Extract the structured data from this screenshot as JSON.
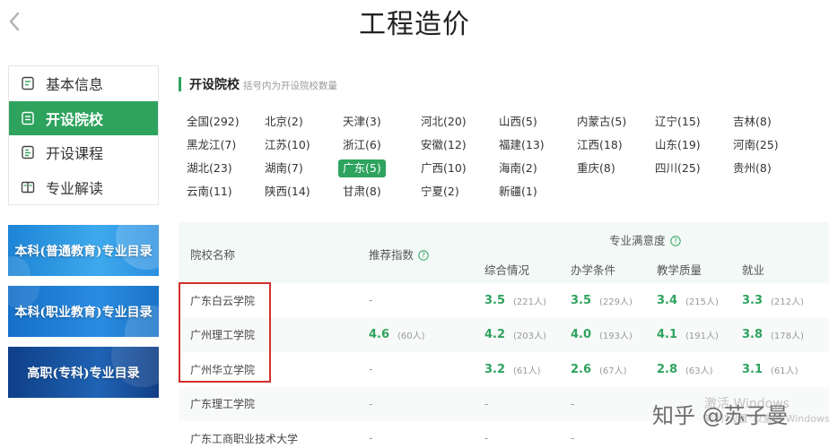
{
  "page": {
    "title": "工程造价"
  },
  "sidebar": {
    "items": [
      {
        "label": "基本信息",
        "icon": "document-icon"
      },
      {
        "label": "开设院校",
        "icon": "school-list-icon"
      },
      {
        "label": "开设课程",
        "icon": "course-icon"
      },
      {
        "label": "专业解读",
        "icon": "book-icon"
      }
    ],
    "active_index": 1,
    "banners": [
      "本科(普通教育)专业目录",
      "本科(职业教育)专业目录",
      "高职(专科)专业目录"
    ]
  },
  "section": {
    "title": "开设院校",
    "note": "括号内为开设院校数量"
  },
  "regions": [
    "全国(292)",
    "北京(2)",
    "天津(3)",
    "河北(20)",
    "山西(5)",
    "内蒙古(5)",
    "辽宁(15)",
    "吉林(8)",
    "黑龙江(7)",
    "江苏(10)",
    "浙江(6)",
    "安徽(12)",
    "福建(13)",
    "江西(18)",
    "山东(19)",
    "河南(25)",
    "湖北(23)",
    "湖南(7)",
    "广东(5)",
    "广西(10)",
    "海南(2)",
    "重庆(8)",
    "四川(25)",
    "贵州(8)",
    "云南(11)",
    "陕西(14)",
    "甘肃(8)",
    "宁夏(2)",
    "新疆(1)"
  ],
  "active_region_index": 18,
  "table": {
    "headers": {
      "school": "院校名称",
      "index": "推荐指数",
      "satisfaction": "专业满意度",
      "overall": "综合情况",
      "conditions": "办学条件",
      "quality": "教学质量",
      "employment": "就业"
    },
    "rows": [
      {
        "name": "广东白云学院",
        "index": "-",
        "index_count": "",
        "overall": "3.5",
        "overall_count": "(221人)",
        "conditions": "3.5",
        "conditions_count": "(229人)",
        "quality": "3.4",
        "quality_count": "(215人)",
        "employment": "3.3",
        "employment_count": "(212人)"
      },
      {
        "name": "广州理工学院",
        "index": "4.6",
        "index_count": "(60人)",
        "overall": "4.2",
        "overall_count": "(203人)",
        "conditions": "4.0",
        "conditions_count": "(193人)",
        "quality": "4.1",
        "quality_count": "(191人)",
        "employment": "3.8",
        "employment_count": "(178人)"
      },
      {
        "name": "广州华立学院",
        "index": "-",
        "index_count": "",
        "overall": "3.2",
        "overall_count": "(61人)",
        "conditions": "2.6",
        "conditions_count": "(67人)",
        "quality": "2.8",
        "quality_count": "(63人)",
        "employment": "3.1",
        "employment_count": "(61人)"
      },
      {
        "name": "广东理工学院",
        "index": "-",
        "index_count": "",
        "overall": "-",
        "overall_count": "",
        "conditions": "-",
        "conditions_count": "",
        "quality": "",
        "quality_count": "",
        "employment": "",
        "employment_count": ""
      },
      {
        "name": "广东工商职业技术大学",
        "index": "-",
        "index_count": "",
        "overall": "-",
        "overall_count": "",
        "conditions": "-",
        "conditions_count": "",
        "quality": "",
        "quality_count": "",
        "employment": "",
        "employment_count": ""
      }
    ]
  },
  "watermark": {
    "zhihu": "知乎 @苏子曼",
    "windows_line1": "激活 Windows",
    "windows_line2": "转到\"设置\"以激活 Windows"
  },
  "colors": {
    "accent": "#2ea35e",
    "highlight_box": "#d2302b"
  }
}
